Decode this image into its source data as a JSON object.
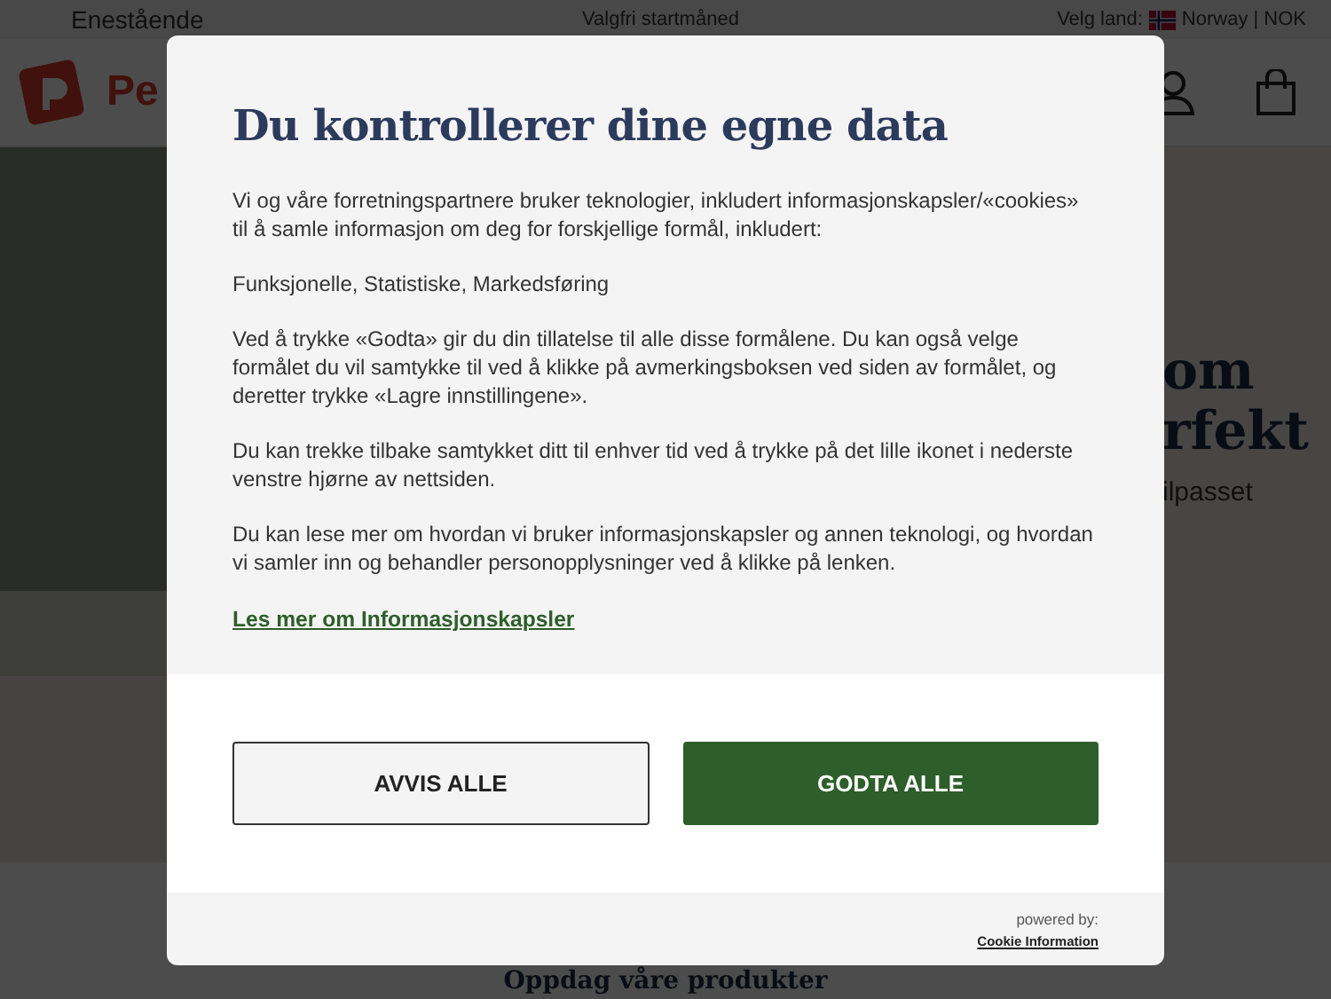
{
  "top_bar": {
    "rating": "Enestående",
    "promo": "Valgfri startmåned",
    "country_label": "Velg land:",
    "country": "Norway | NOK"
  },
  "header": {
    "logo_text": "Pe"
  },
  "hero": {
    "title_lines": [
      "om",
      "rfekt"
    ],
    "subtitle": "ilpasset"
  },
  "section": {
    "heading": "Oppdag våre produkter"
  },
  "dialog": {
    "title": "Du kontrollerer dine egne data",
    "paragraphs": [
      "Vi og våre forretningspartnere bruker teknologier, inkludert informasjonskapsler/«cookies» til å samle informasjon om deg for forskjellige formål, inkludert:",
      "Funksjonelle, Statistiske, Markedsføring",
      "Ved å trykke «Godta» gir du din tillatelse til alle disse formålene. Du kan også velge formålet du vil samtykke til ved å klikke på avmerkingsboksen ved siden av formålet, og deretter trykke «Lagre innstillingene».",
      "Du kan trekke tilbake samtykket ditt til enhver tid ved å trykke på det lille ikonet i nederste venstre hjørne av nettsiden.",
      "Du kan lese mer om hvordan vi bruker informasjonskapsler og annen teknologi, og hvordan vi samler inn og behandler personopplysninger ved å klikke på lenken."
    ],
    "link": "Les mer om Informasjonskapsler",
    "buttons": [
      {
        "label": "AVVIS ALLE",
        "kind": "secondary"
      },
      {
        "label": "GODTA ALLE",
        "kind": "primary"
      }
    ],
    "powered_by": "powered by:",
    "provider": "Cookie Information"
  }
}
